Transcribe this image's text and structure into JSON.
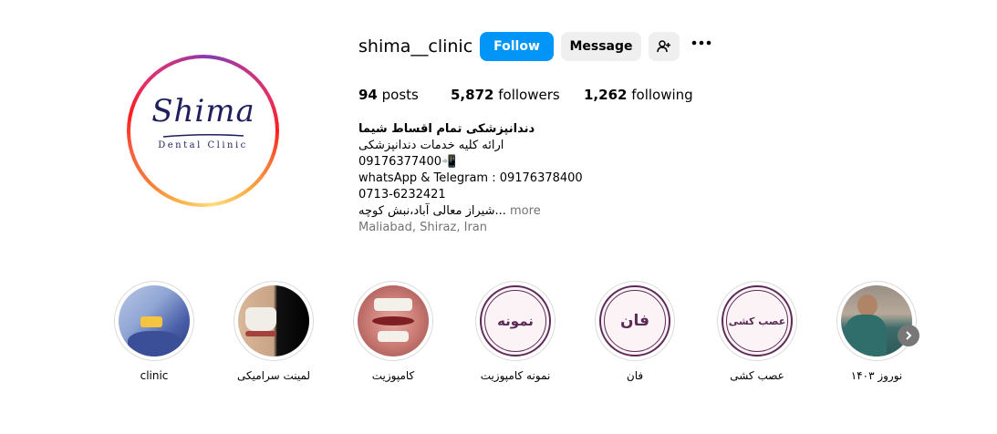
{
  "profile": {
    "username": "shima__clinic",
    "avatar_logo_main": "Shima",
    "avatar_logo_sub": "Dental Clinic",
    "follow_label": "Follow",
    "message_label": "Message",
    "add_user_icon": "person-add-icon",
    "more_icon": "more-horizontal-icon"
  },
  "stats": {
    "posts_count": "94",
    "posts_label": "posts",
    "followers_count": "5,872",
    "followers_label": "followers",
    "following_count": "1,262",
    "following_label": "following"
  },
  "bio": {
    "name": "دندانپزشکی تمام اقساط شیما",
    "line1": "ارائه کلیه خدمات دندانپزشکی",
    "line2": "09176377400📲",
    "line3": "whatsApp & Telegram : 09176378400",
    "line4": "0713-6232421",
    "line5": "شیراز معالی آباد،نبش کوچه...",
    "more_label": "more",
    "location": "Maliabad, Shiraz, Iran"
  },
  "highlights": [
    {
      "label": "clinic"
    },
    {
      "label": "لمینت سرامیکی"
    },
    {
      "label": "کامپوزیت"
    },
    {
      "label": "نمونه کامپوزیت",
      "cover_text": "نمونه"
    },
    {
      "label": "فان",
      "cover_text": "فان"
    },
    {
      "label": "عصب کشی",
      "cover_text": "عصب کشی"
    },
    {
      "label": "نوروز ۱۴۰۳"
    }
  ],
  "highlights_next_icon": "chevron-right-icon",
  "colors": {
    "follow_blue": "#0095f6",
    "button_gray": "#efefef",
    "muted_text": "#737373",
    "highlight_purple": "#5c2a57"
  }
}
